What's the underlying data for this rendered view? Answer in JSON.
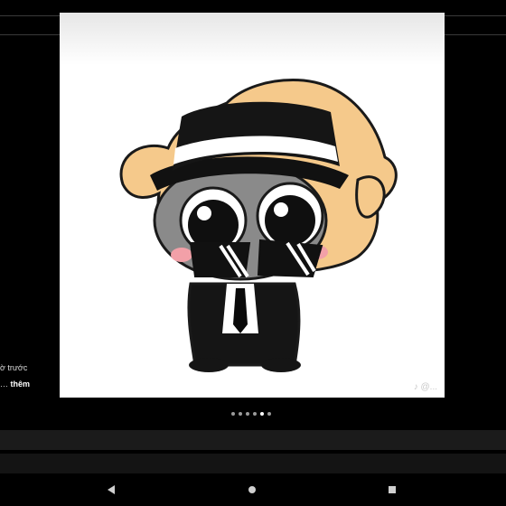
{
  "caption": {
    "time_text": "ờ trước",
    "more_prefix": "…",
    "more_label": "thêm"
  },
  "watermark": "♪ @...",
  "carousel": {
    "count": 6,
    "active_index": 4
  },
  "nav": {
    "back_icon": "back-triangle-icon",
    "home_icon": "home-circle-icon",
    "recents_icon": "recents-square-icon"
  },
  "colors": {
    "background": "#000000",
    "skin": "#f5c98b",
    "outline": "#1a1a1a"
  }
}
